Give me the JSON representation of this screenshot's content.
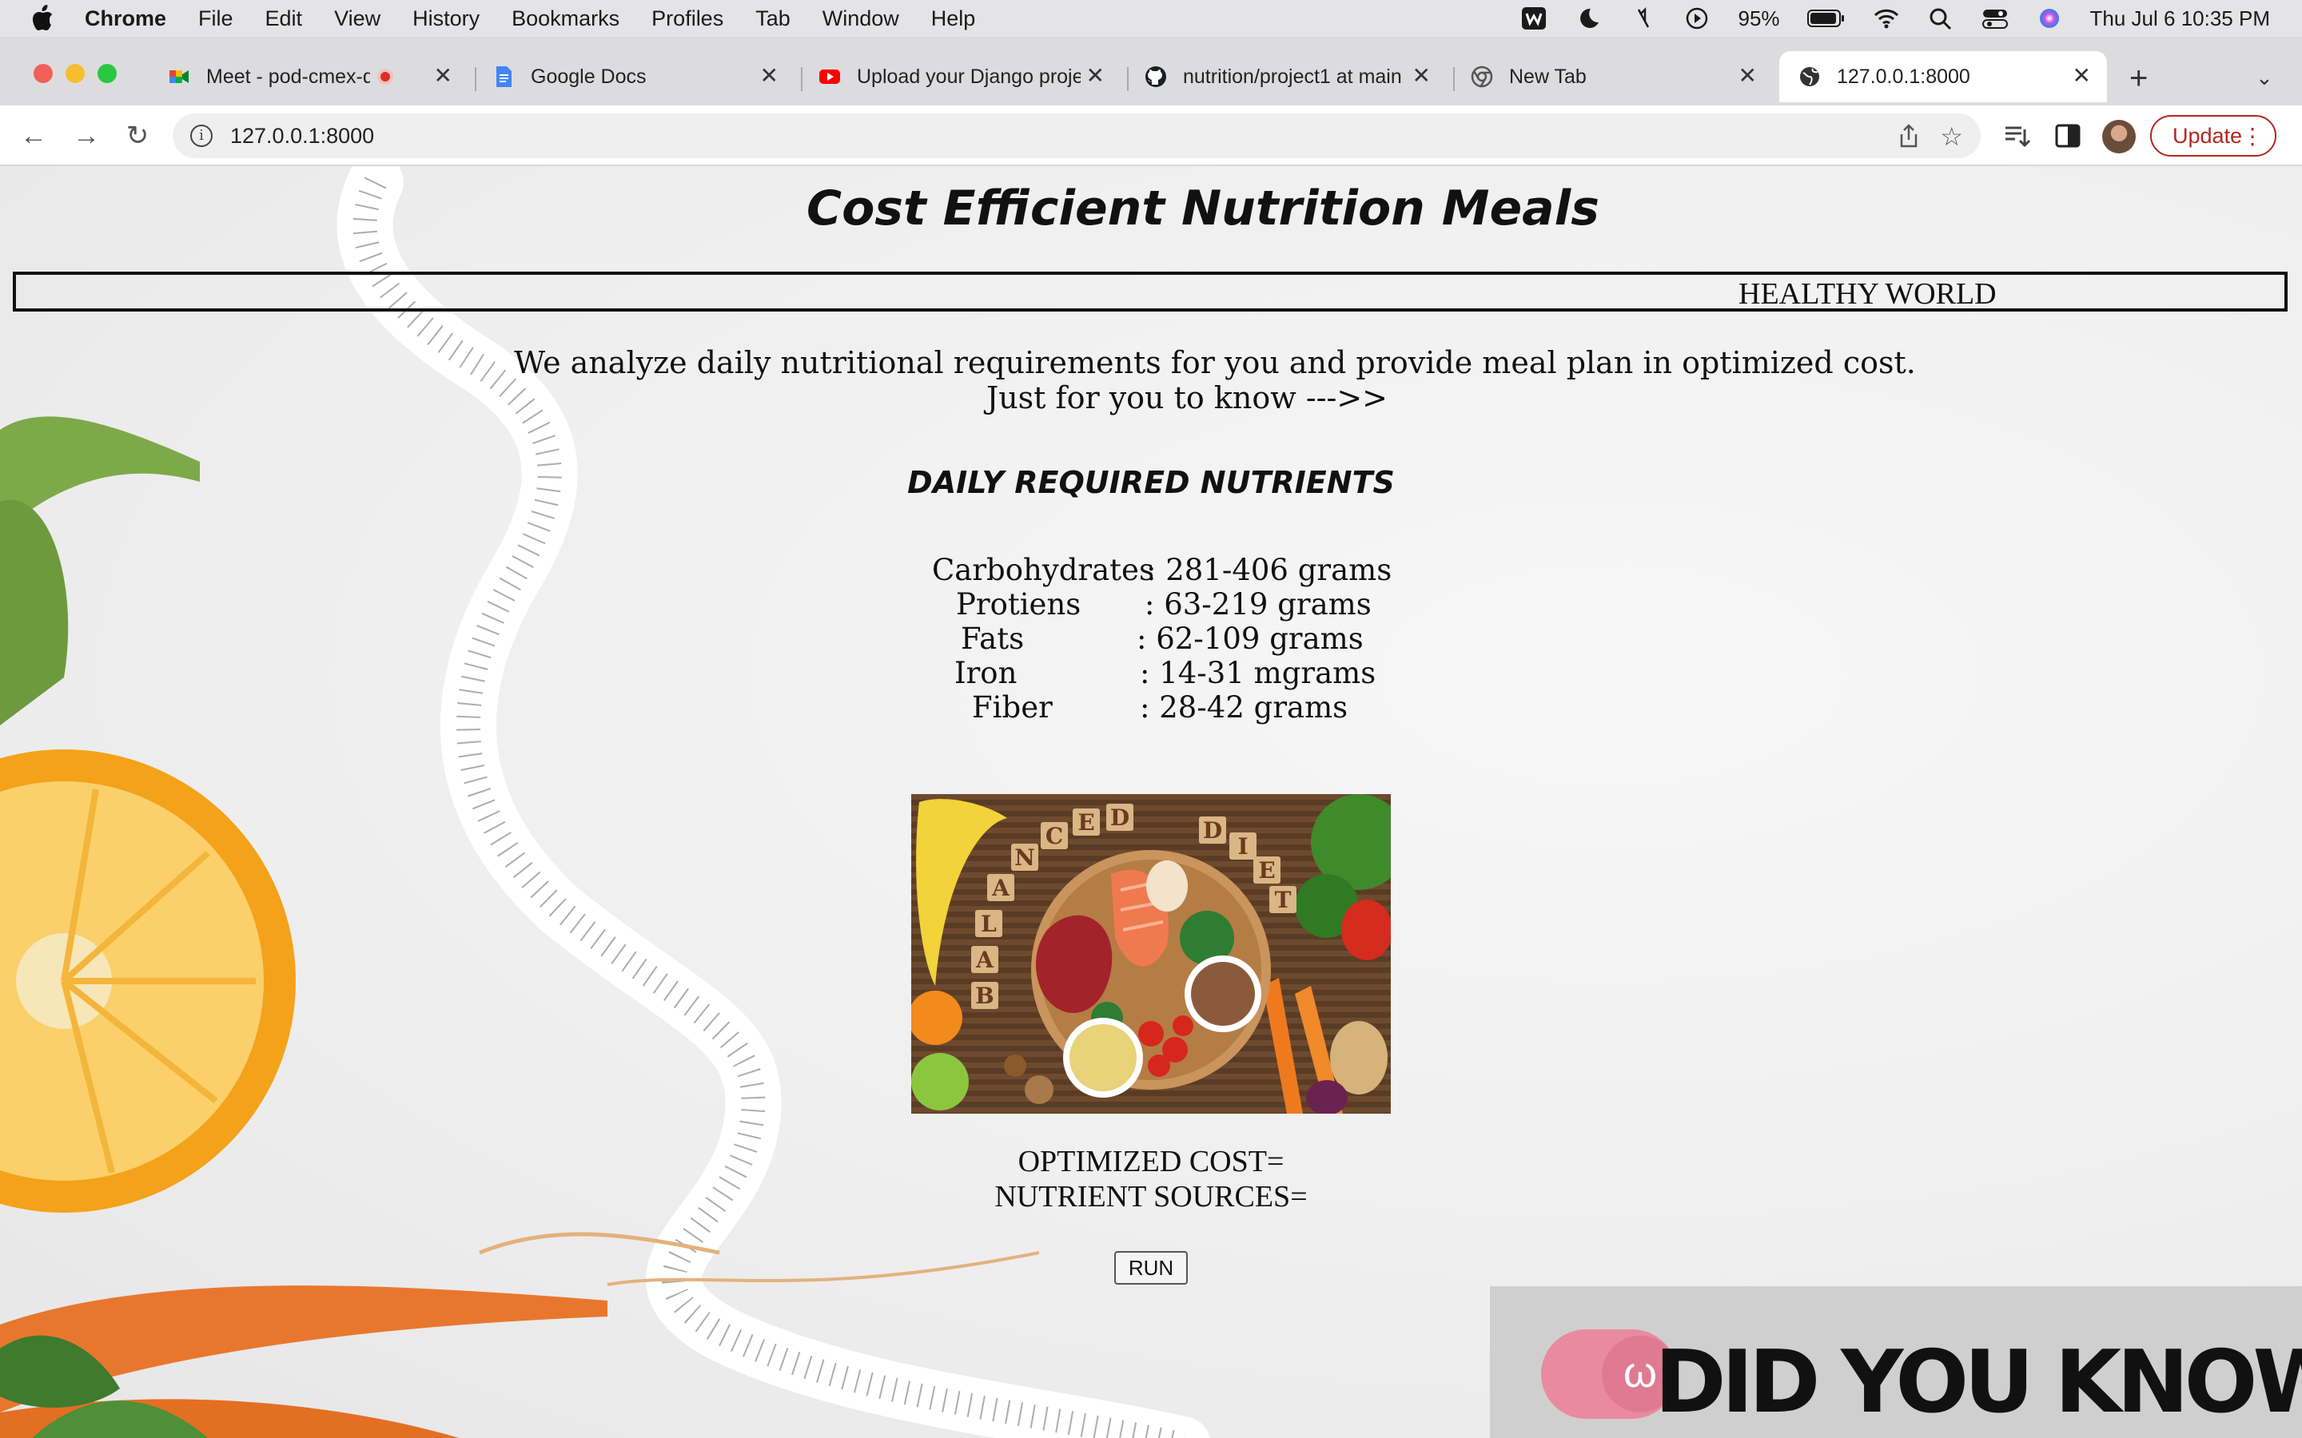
{
  "menubar": {
    "app_name": "Chrome",
    "items": [
      "File",
      "Edit",
      "View",
      "History",
      "Bookmarks",
      "Profiles",
      "Tab",
      "Window",
      "Help"
    ],
    "battery": "95%",
    "datetime": "Thu Jul 6  10:35 PM"
  },
  "tabs": [
    {
      "title": "Meet - pod-cmex-db",
      "favicon": "google-meet-icon",
      "recording": true
    },
    {
      "title": "Google Docs",
      "favicon": "google-docs-icon"
    },
    {
      "title": "Upload your Django proje",
      "favicon": "youtube-icon"
    },
    {
      "title": "nutrition/project1 at main",
      "favicon": "github-icon"
    },
    {
      "title": "New Tab",
      "favicon": "chrome-icon"
    },
    {
      "title": "127.0.0.1:8000",
      "favicon": "globe-icon",
      "active": true
    }
  ],
  "toolbar": {
    "url": "127.0.0.1:8000",
    "update_label": "Update"
  },
  "page": {
    "title": "Cost Efficient Nutrition Meals",
    "marquee": "HEALTHY WORLD",
    "intro_line1": "We analyze daily nutritional requirements for you and provide meal plan in optimized cost.",
    "intro_line2": "Just for you to know --->>",
    "nutrients_heading": "DAILY REQUIRED NUTRIENTS",
    "nutrients": [
      {
        "name": "Carbohydrates",
        "value": ": 281-406 grams"
      },
      {
        "name": "Protiens",
        "value": ": 63-219 grams"
      },
      {
        "name": "Fats",
        "value": ": 62-109 grams"
      },
      {
        "name": "Iron",
        "value": ": 14-31 mgrams"
      },
      {
        "name": "Fiber",
        "value": ": 28-42 grams"
      }
    ],
    "image_letters": [
      "B",
      "A",
      "L",
      "A",
      "N",
      "C",
      "E",
      "D",
      "D",
      "I",
      "E",
      "T"
    ],
    "optimized_cost_label": "OPTIMIZED COST=",
    "nutrient_sources_label": "NUTRIENT SOURCES=",
    "run_label": "RUN",
    "banner_text": "DID YOU KNOW ?"
  },
  "colors": {
    "accent_red": "#b3261e",
    "banner_pink": "#e98aa0"
  }
}
